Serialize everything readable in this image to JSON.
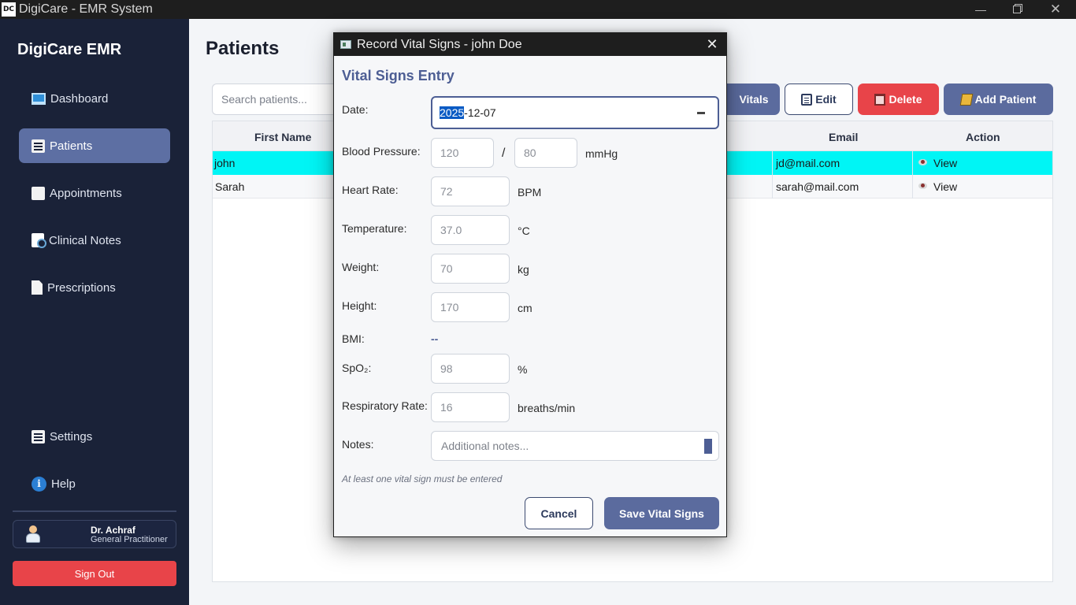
{
  "window": {
    "logo": "DC",
    "title": "DigiCare - EMR System"
  },
  "sidebar": {
    "brand": "DigiCare EMR",
    "items": [
      {
        "label": "Dashboard",
        "icon": "monitor-icon"
      },
      {
        "label": "Patients",
        "icon": "document-icon",
        "active": true
      },
      {
        "label": "Appointments",
        "icon": "grid-icon"
      },
      {
        "label": "Clinical Notes",
        "icon": "notes-search-icon"
      },
      {
        "label": "Prescriptions",
        "icon": "page-icon"
      },
      {
        "label": "Settings",
        "icon": "document-icon"
      },
      {
        "label": "Help",
        "icon": "info-icon"
      }
    ],
    "user": {
      "name": "Dr. Achraf",
      "role": "General Practitioner"
    },
    "signout_label": "Sign Out"
  },
  "main": {
    "title": "Patients",
    "search_placeholder": "Search patients...",
    "toolbar": {
      "vitals_label": "Vitals",
      "edit_label": "Edit",
      "delete_label": "Delete",
      "add_label": "Add Patient"
    },
    "table": {
      "columns": [
        "First Name",
        "Email",
        "Action"
      ],
      "rows": [
        {
          "first_name": "john",
          "email": "jd@mail.com",
          "action": "View",
          "selected": true
        },
        {
          "first_name": "Sarah",
          "email": "sarah@mail.com",
          "action": "View",
          "selected": false
        }
      ]
    }
  },
  "dialog": {
    "title": "Record Vital Signs - john Doe",
    "heading": "Vital Signs Entry",
    "date": {
      "label": "Date:",
      "year": "2025",
      "rest": "-12-07"
    },
    "blood_pressure": {
      "label": "Blood Pressure:",
      "systolic": "120",
      "separator": "/",
      "diastolic": "80",
      "unit": "mmHg"
    },
    "heart_rate": {
      "label": "Heart Rate:",
      "value": "72",
      "unit": "BPM"
    },
    "temperature": {
      "label": "Temperature:",
      "value": "37.0",
      "unit": "°C"
    },
    "weight": {
      "label": "Weight:",
      "value": "70",
      "unit": "kg"
    },
    "height": {
      "label": "Height:",
      "value": "170",
      "unit": "cm"
    },
    "bmi": {
      "label": "BMI:",
      "value": "--"
    },
    "spo2": {
      "label": "SpO₂:",
      "value": "98",
      "unit": "%"
    },
    "respiratory_rate": {
      "label": "Respiratory Rate:",
      "value": "16",
      "unit": "breaths/min"
    },
    "notes": {
      "label": "Notes:",
      "placeholder": "Additional notes..."
    },
    "hint": "At least one vital sign must be entered",
    "cancel_label": "Cancel",
    "save_label": "Save Vital Signs"
  },
  "colors": {
    "accent": "#5b6b9e",
    "danger": "#e84449",
    "sidebar_bg": "#1a2238",
    "selected_row": "#00f5f5"
  }
}
